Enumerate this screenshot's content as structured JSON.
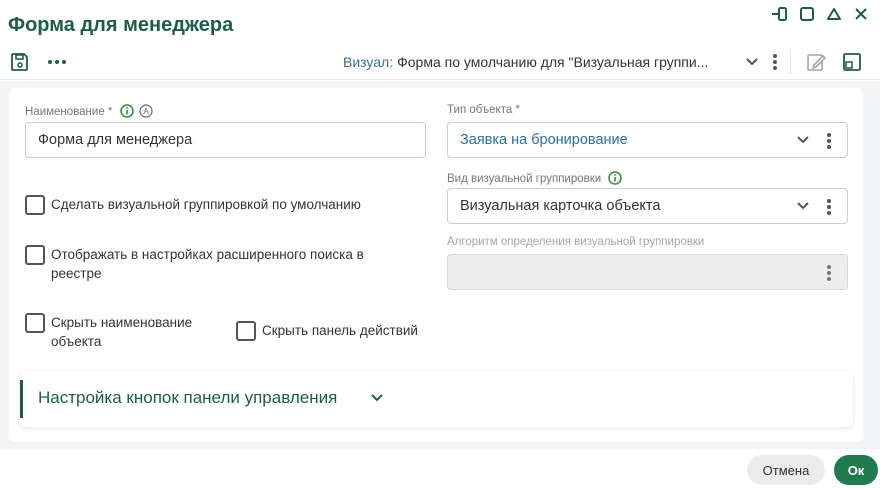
{
  "window": {
    "title": "Форма для менеджера",
    "controls": [
      "pin-icon",
      "maximize-icon",
      "collapse-icon",
      "close-icon"
    ]
  },
  "toolbar": {
    "save_icon": "save-icon",
    "more_icon": "more-horizontal-icon",
    "visual_key": "Визуал:",
    "visual_value": "Форма по умолчанию для \"Визуальная группи...",
    "edit_icon": "edit-icon",
    "layout_icon": "layout-icon"
  },
  "form": {
    "name_label": "Наименование *",
    "name_value": "Форма для менеджера",
    "object_type_label": "Тип объекта *",
    "object_type_value": "Заявка на бронирование",
    "visual_group_label": "Вид визуальной группировки",
    "visual_group_value": "Визуальная карточка объекта",
    "algorithm_label": "Алгоритм определения визуальной группировки",
    "algorithm_value": "",
    "cb_default_group": "Сделать визуальной группировкой по умолчанию",
    "cb_show_advanced_line1": "Отображать в настройках расширенного поиска в",
    "cb_show_advanced_line2": "реестре",
    "cb_hide_name_line1": "Скрыть наименование",
    "cb_hide_name_line2": "объекта",
    "cb_hide_actions": "Скрыть панель действий"
  },
  "section": {
    "title": "Настройка кнопок панели управления"
  },
  "footer": {
    "cancel": "Отмена",
    "ok": "Ок"
  },
  "colors": {
    "accent": "#1f5c45",
    "ok_button": "#1f7a4d",
    "info_icon": "#2e8b3a",
    "link": "#2a6ea6"
  }
}
